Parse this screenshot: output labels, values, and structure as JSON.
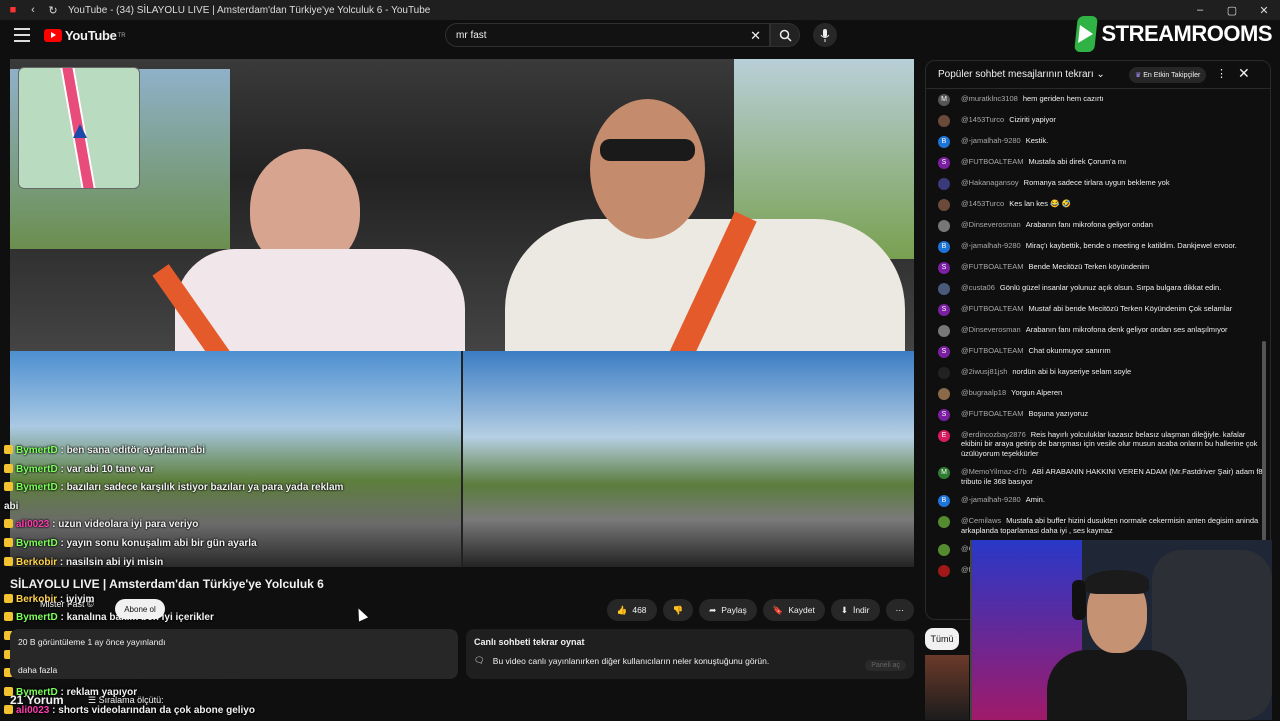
{
  "browser": {
    "title": "YouTube - (34) SİLAYOLU LIVE | Amsterdam'dan Türkiye'ye Yolculuk 6 - YouTube"
  },
  "youtube": {
    "logo_text": "YouTube",
    "country": "TR",
    "search_value": "mr fast"
  },
  "overlay_logo": "STREAMROOMS",
  "video_chat_overlay": [
    {
      "user": "BymertD",
      "text": ": ben sana editör ayarlarım abi",
      "style": "u"
    },
    {
      "user": "BymertD",
      "text": ": var abi 10 tane var",
      "style": "u"
    },
    {
      "user": "BymertD",
      "text": ": bazıları sadece karşılık istiyor bazıları ya para yada reklam",
      "style": "u"
    },
    {
      "user": "",
      "text": "abi",
      "style": "u"
    },
    {
      "user": "ali0023",
      "text": ": uzun videolara iyi para veriyo",
      "style": "u3"
    },
    {
      "user": "BymertD",
      "text": ": yayın sonu konuşalım abi bir gün ayarla",
      "style": "u"
    },
    {
      "user": "Berkobir",
      "text": ": nasilsin abi iyi misin",
      "style": "u2"
    },
    {
      "user": "",
      "text": "",
      "style": "u"
    },
    {
      "user": "Berkobir",
      "text": ": iyiyim",
      "style": "u2"
    },
    {
      "user": "BymertD",
      "text": ": kanalına bakım ben iyi içerikler",
      "style": "u"
    },
    {
      "user": "BymertD",
      "text": ": niye izlenmiyor anlamadım sadece",
      "style": "u"
    },
    {
      "user": "ali0023",
      "text": ": popüler biri seni tanıtsa devamı gelir",
      "style": "u3"
    },
    {
      "user": "BymertD",
      "text": ": ama o adamda para var teklam yapıyor",
      "style": "u"
    },
    {
      "user": "BymertD",
      "text": ": reklam yapıyor",
      "style": "u"
    },
    {
      "user": "ali0023",
      "text": ": shorts videolarından da çok abone geliyo",
      "style": "u3"
    }
  ],
  "video": {
    "title": "SİLAYOLU LIVE | Amsterdam'dan Türkiye'ye Yolculuk 6",
    "channel": "Mister Fast ©",
    "subscribe": "Abone ol",
    "likes": "468",
    "share": "Paylaş",
    "save": "Kaydet",
    "download": "İndir",
    "views": "20 B görüntüleme  1 ay önce yayınlandı",
    "more": "daha fazla",
    "comments": "21 Yorum",
    "sort": "Sıralama ölçütü:"
  },
  "replay": {
    "heading": "Canlı sohbeti tekrar oynat",
    "body": "Bu video canlı yayınlanırken diğer kullanıcıların neler konuştuğunu görün.",
    "button": "Paneli aç"
  },
  "chat": {
    "header": "Popüler sohbet mesajlarının tekrarı",
    "pill": "En Etkin Takipçiler",
    "messages": [
      {
        "author": "@muratklnc3108",
        "text": "hem geriden hem cazırtı",
        "avatar": "M",
        "color": "#555"
      },
      {
        "author": "@1453Turco",
        "text": "Ciziriti yapiyor",
        "avatar": "",
        "color": "#6b4a3a"
      },
      {
        "author": "@-jamalhah-9280",
        "text": "Kestik.",
        "avatar": "B",
        "color": "#1e73d6"
      },
      {
        "author": "@FUTBOALTEAM",
        "text": "Mustafa abi direk Çorum'a mı",
        "avatar": "S",
        "color": "#7b1fa2"
      },
      {
        "author": "@Hakanagansoy",
        "text": "Romanya sadece tirlara uygun bekleme yok",
        "avatar": "",
        "color": "#3a3a7a"
      },
      {
        "author": "@1453Turco",
        "text": "Kes lan kes 😂 🤣",
        "avatar": "",
        "color": "#6b4a3a"
      },
      {
        "author": "@Dinseverosman",
        "text": "Arabanın fanı mikrofona geliyor ondan",
        "avatar": "",
        "color": "#777"
      },
      {
        "author": "@-jamalhah-9280",
        "text": "Miraç'ı kaybettik, bende o meeting e katildim. Dankjewel ervoor.",
        "avatar": "B",
        "color": "#1e73d6"
      },
      {
        "author": "@FUTBOALTEAM",
        "text": "Bende Mecitözü Terken köyündenim",
        "avatar": "S",
        "color": "#7b1fa2"
      },
      {
        "author": "@custa06",
        "text": "Gönlü güzel insanlar yolunuz açık olsun. Sırpa bulgara dikkat edin.",
        "avatar": "",
        "color": "#4a5a7a"
      },
      {
        "author": "@FUTBOALTEAM",
        "text": "Mustaf abi bende Mecitözü Terken Köyündenim Çok selamlar",
        "avatar": "S",
        "color": "#7b1fa2"
      },
      {
        "author": "@Dinseverosman",
        "text": "Arabanın fanı mikrofona denk geliyor ondan ses anlaşılmıyor",
        "avatar": "",
        "color": "#777"
      },
      {
        "author": "@FUTBOALTEAM",
        "text": "Chat okunmuyor sanırım",
        "avatar": "S",
        "color": "#7b1fa2"
      },
      {
        "author": "@2iwusj81jsh",
        "text": "nordün abi bi kayseriye selam soyle",
        "avatar": "",
        "color": "#222"
      },
      {
        "author": "@bugraalp18",
        "text": "Yorgun Alperen",
        "avatar": "",
        "color": "#8a6a4a"
      },
      {
        "author": "@FUTBOALTEAM",
        "text": "Boşuna yazıyoruz",
        "avatar": "S",
        "color": "#7b1fa2"
      },
      {
        "author": "@erdincozbay2876",
        "text": "Reis hayırlı yolculuklar kazasız belasız ulaşman dileğiyle. kafalar ekibini bir araya getirip de barışması için vesile olur musun acaba onların bu hallerine çok üzülüyorum teşekkürler",
        "avatar": "E",
        "color": "#d81b60"
      },
      {
        "author": "@MemoYilmaz-d7b",
        "text": "ABİ ARABANIN HAKKINI VEREN ADAM (Mr.Fastdriver Şair) adam f8 tributo ile 368 basıyor",
        "avatar": "M",
        "color": "#2e7d32"
      },
      {
        "author": "@-jamalhah-9280",
        "text": "Amin.",
        "avatar": "B",
        "color": "#1e73d6"
      },
      {
        "author": "@Cemilaws",
        "text": "Mustafa abi buffer hizini dusukten normale cekermisin anten degisim aninda arkaplanda toparlamasi daha iyi , ses kaymaz",
        "avatar": "",
        "color": "#558b2f"
      },
      {
        "author": "@Cemilaws",
        "text": "Ultra low latency kotu arac icin",
        "avatar": "",
        "color": "#558b2f"
      },
      {
        "author": "@fatihkeskin4665",
        "text": "Emirdag bekleriz birdaha abi",
        "avatar": "",
        "color": "#a01818"
      }
    ]
  },
  "filters": {
    "all": "Tümü"
  }
}
